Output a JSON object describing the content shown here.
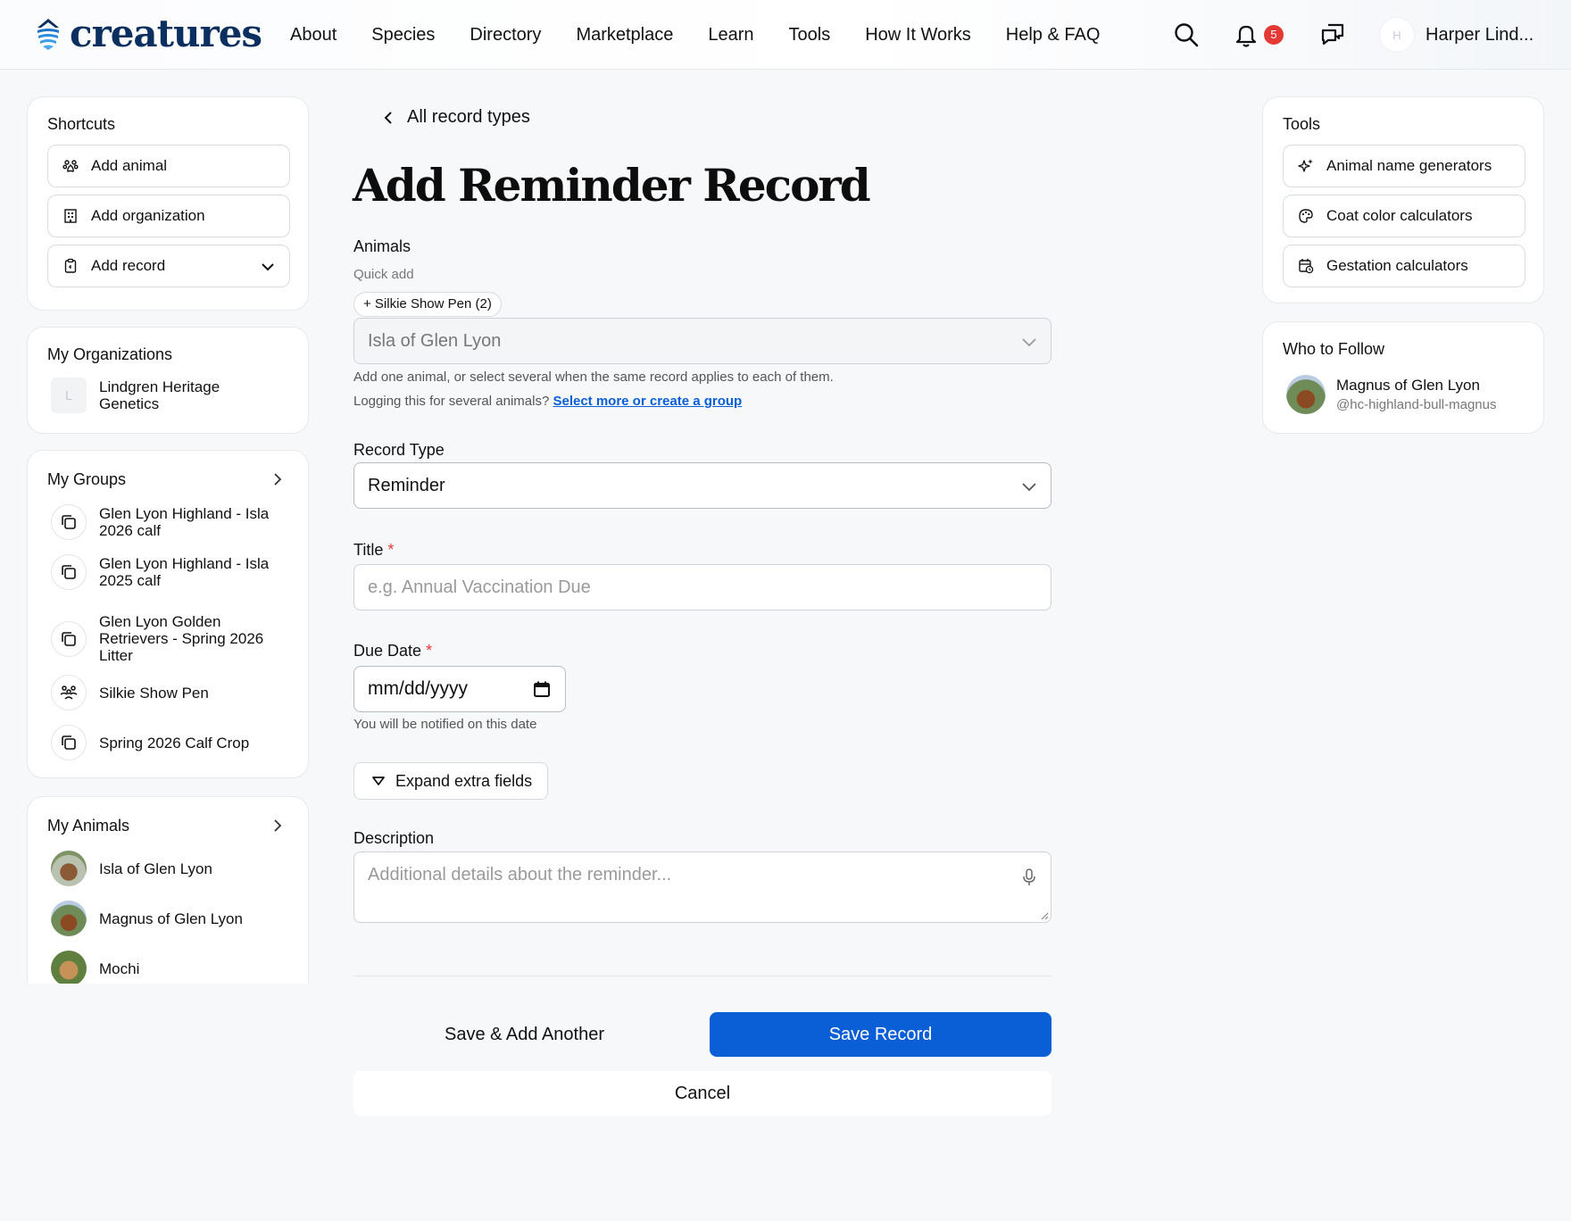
{
  "header": {
    "brand": "creatures",
    "nav": [
      "About",
      "Species",
      "Directory",
      "Marketplace",
      "Learn",
      "Tools",
      "How It Works",
      "Help & FAQ"
    ],
    "notifications_count": "5",
    "user_initial": "H",
    "user_name": "Harper Lind..."
  },
  "shortcuts": {
    "title": "Shortcuts",
    "items": [
      "Add animal",
      "Add organization",
      "Add record"
    ]
  },
  "organizations": {
    "title": "My Organizations",
    "items": [
      {
        "initial": "L",
        "name": "Lindgren Heritage Genetics"
      }
    ]
  },
  "groups": {
    "title": "My Groups",
    "items": [
      "Glen Lyon Highland - Isla 2026 calf",
      "Glen Lyon Highland - Isla 2025 calf",
      "Glen Lyon Golden Retrievers - Spring 2026 Litter",
      "Silkie Show Pen",
      "Spring 2026 Calf Crop"
    ]
  },
  "animals": {
    "title": "My Animals",
    "items": [
      "Isla of Glen Lyon",
      "Magnus of Glen Lyon",
      "Mochi"
    ]
  },
  "form": {
    "back_label": "All record types",
    "title": "Add Reminder Record",
    "animals_label": "Animals",
    "quick_add_label": "Quick add",
    "quick_add_chip": "+ Silkie Show Pen (2)",
    "animals_value": "Isla of Glen Lyon",
    "animals_help": "Add one animal, or select several when the same record applies to each of them.",
    "group_help_prefix": "Logging this for several animals? ",
    "group_help_link": "Select more or create a group",
    "record_type_label": "Record Type",
    "record_type_value": "Reminder",
    "title_label": "Title",
    "required_mark": "*",
    "title_placeholder": "e.g. Annual Vaccination Due",
    "due_date_label": "Due Date",
    "due_date_placeholder": "mm/dd/yyyy",
    "due_date_help": "You will be notified on this date",
    "expand_label": "Expand extra fields",
    "description_label": "Description",
    "description_placeholder": "Additional details about the reminder...",
    "save_add_another": "Save & Add Another",
    "save": "Save Record",
    "cancel": "Cancel"
  },
  "tools": {
    "title": "Tools",
    "items": [
      "Animal name generators",
      "Coat color calculators",
      "Gestation calculators"
    ]
  },
  "follow": {
    "title": "Who to Follow",
    "name": "Magnus of Glen Lyon",
    "handle": "@hc-highland-bull-magnus"
  },
  "colors": {
    "primary": "#0a5fd6",
    "brand": "#0b2f5e",
    "badge": "#e53935"
  }
}
